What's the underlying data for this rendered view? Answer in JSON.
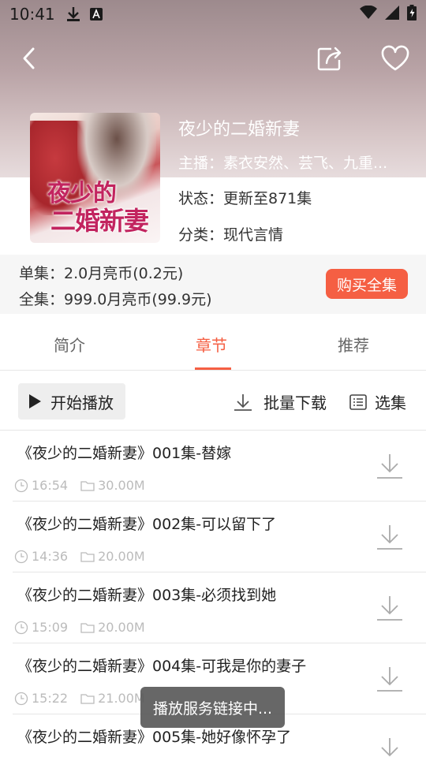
{
  "statusbar": {
    "time": "10:41"
  },
  "book": {
    "title": "夜少的二婚新妻",
    "anchor": "主播：素衣安然、芸飞、九重...",
    "status": "状态：更新至871集",
    "category": "分类：现代言情",
    "cover_title_line1": "夜少的",
    "cover_title_line2": "二婚新妻"
  },
  "price": {
    "single": "单集：2.0月亮币(0.2元)",
    "all": "全集：999.0月亮币(99.9元)",
    "buy_label": "购买全集"
  },
  "tabs": [
    {
      "label": "简介"
    },
    {
      "label": "章节"
    },
    {
      "label": "推荐"
    }
  ],
  "toolbar": {
    "play_label": "开始播放",
    "batch_label": "批量下载",
    "select_label": "选集"
  },
  "episodes": [
    {
      "title": "《夜少的二婚新妻》001集-替嫁",
      "duration": "16:54",
      "size": "30.00M"
    },
    {
      "title": "《夜少的二婚新妻》002集-可以留下了",
      "duration": "14:36",
      "size": "20.00M"
    },
    {
      "title": "《夜少的二婚新妻》003集-必须找到她",
      "duration": "15:09",
      "size": "20.00M"
    },
    {
      "title": "《夜少的二婚新妻》004集-可我是你的妻子",
      "duration": "15:22",
      "size": "21.00M"
    },
    {
      "title": "《夜少的二婚新妻》005集-她好像怀孕了",
      "duration": "",
      "size": ""
    }
  ],
  "toast": "播放服务链接中...",
  "colors": {
    "accent": "#f55f43",
    "hero_top": "#9d8a8d"
  }
}
